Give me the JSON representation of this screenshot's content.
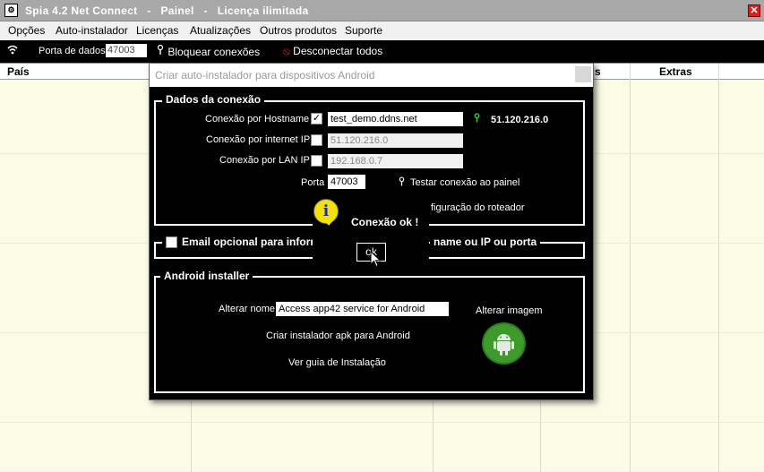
{
  "window": {
    "title": "Spia 4.2 Net Connect   -   Painel   -   Licença ilimitada",
    "close_glyph": "✕"
  },
  "menu": {
    "items": [
      "Opções",
      "Auto-instalador",
      "Licenças",
      "Atualizações",
      "Outros produtos",
      "Suporte"
    ]
  },
  "toolbar": {
    "port_label": "Porta de dados:",
    "port_value": "47003",
    "block_label": "Bloquear conexões",
    "disconnect_label": "Desconectar todos"
  },
  "grid": {
    "columns": [
      "País",
      "s",
      "Extras"
    ]
  },
  "dialog": {
    "title": "Criar auto-instalador para dispositivos Android",
    "connection_group": {
      "legend": "Dados da conexão",
      "hostname_label": "Conexão por Hostname",
      "hostname_checked": true,
      "hostname_value": "test_demo.ddns.net",
      "hostname_ip": "51.120.216.0",
      "internet_label": "Conexão por internet IP",
      "internet_checked": false,
      "internet_value": "51.120.216.0",
      "lan_label": "Conexão por LAN IP",
      "lan_checked": false,
      "lan_value": "192.168.0.7",
      "port_label": "Porta",
      "port_value": "47003",
      "test_label": "Testar conexão ao painel",
      "router_label": "figuração do roteador"
    },
    "email_group": {
      "label_left": "Email opcional para inform",
      "label_right": "name ou IP ou porta"
    },
    "android_group": {
      "legend": "Android installer",
      "rename_label": "Alterar nome",
      "rename_value": "Access app42 service for Android",
      "change_image_label": "Alterar imagem",
      "create_apk_label": "Criar instalador apk para Android",
      "guide_label": "Ver guia de Instalação"
    },
    "message": {
      "text": "Conexão ok !",
      "ok_label": "ok"
    }
  },
  "colors": {
    "accent_green": "#3f9a2c",
    "info_yellow": "#f2e20a",
    "disconnect_red": "#e03030"
  }
}
